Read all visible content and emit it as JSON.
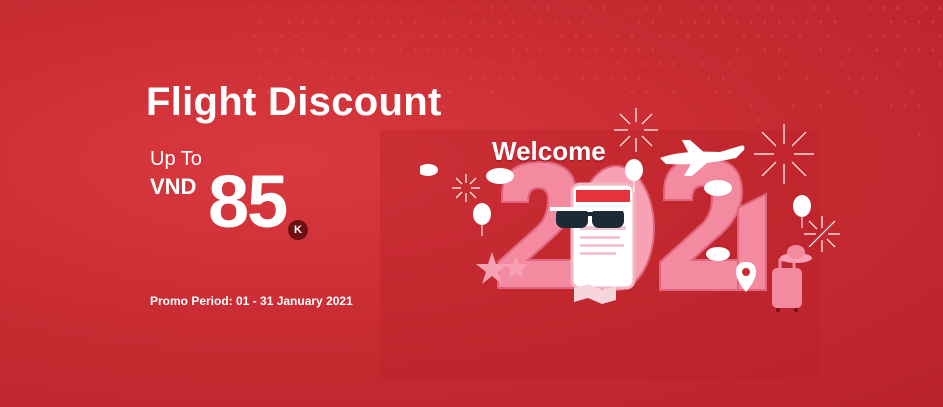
{
  "banner": {
    "title": "Flight Discount",
    "up_to": "Up To",
    "currency": "VND",
    "amount": "85",
    "amount_unit": "K",
    "promo_period": "Promo Period: 01 - 31 January 2021",
    "welcome": "Welcome",
    "year_digits": [
      "2",
      "0",
      "2",
      "1"
    ]
  },
  "colors": {
    "background": "#c92c33",
    "text": "#ffffff",
    "numbers_pink": "#f48aa0",
    "badge": "#6e0f14"
  },
  "icons": [
    "airplane-icon",
    "sunglasses-icon",
    "phone-icon",
    "balloon-icon",
    "firework-icon",
    "cloud-icon",
    "location-pin-icon",
    "suitcase-icon",
    "hat-icon",
    "starfish-icon",
    "map-icon"
  ]
}
